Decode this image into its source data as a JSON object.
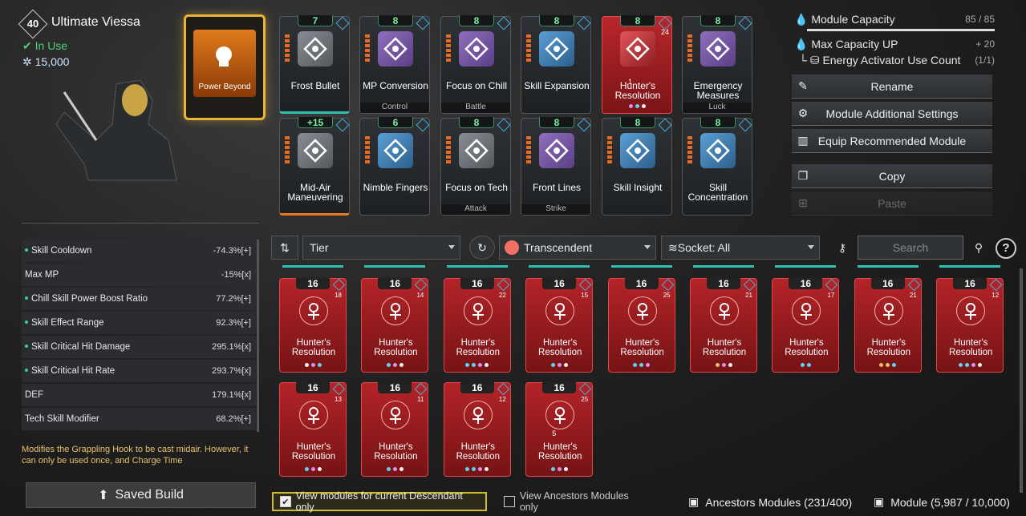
{
  "character": {
    "level": "40",
    "name": "Ultimate Viessa",
    "status": "In Use",
    "gold": "15,000"
  },
  "power_beyond": {
    "label": "Power Beyond"
  },
  "equipped": [
    {
      "badge": "7",
      "name": "Frost Bullet",
      "sub": "",
      "color": "gray"
    },
    {
      "badge": "8",
      "name": "MP Conversion",
      "sub": "Control",
      "color": "purple"
    },
    {
      "badge": "8",
      "name": "Focus on Chill",
      "sub": "Battle",
      "color": "purple"
    },
    {
      "badge": "8",
      "name": "Skill Expansion",
      "sub": "",
      "color": "blue"
    },
    {
      "badge": "8",
      "name": "Hunter's Resolution",
      "sub": "",
      "color": "red",
      "rank": "24",
      "count": "1"
    },
    {
      "badge": "8",
      "name": "Emergency Measures",
      "sub": "Luck",
      "color": "purple"
    },
    {
      "badge": "+15",
      "name": "Mid-Air Maneuvering",
      "sub": "",
      "color": "gray"
    },
    {
      "badge": "6",
      "name": "Nimble Fingers",
      "sub": "",
      "color": "blue"
    },
    {
      "badge": "8",
      "name": "Focus on Tech",
      "sub": "Attack",
      "color": "gray"
    },
    {
      "badge": "8",
      "name": "Front Lines",
      "sub": "Strike",
      "color": "purple"
    },
    {
      "badge": "8",
      "name": "Skill Insight",
      "sub": "",
      "color": "blue"
    },
    {
      "badge": "8",
      "name": "Skill Concentration",
      "sub": "",
      "color": "blue"
    }
  ],
  "capacity": {
    "label": "Module Capacity",
    "value": "85 / 85",
    "fill": 1.0,
    "max_label": "Max Capacity UP",
    "max_value": "+ 20",
    "energy_label": "Energy Activator Use Count",
    "energy_value": "(1/1)"
  },
  "buttons": {
    "rename": "Rename",
    "additional": "Module Additional Settings",
    "recommended": "Equip Recommended Module",
    "copy": "Copy",
    "paste": "Paste"
  },
  "stats": [
    {
      "name": "Skill Cooldown",
      "value": "-74.3%[+]",
      "dot": true
    },
    {
      "name": "Max MP",
      "value": "-15%[x]",
      "dot": false
    },
    {
      "name": "Chill Skill Power Boost Ratio",
      "value": "77.2%[+]",
      "dot": true
    },
    {
      "name": "Skill Effect Range",
      "value": "92.3%[+]",
      "dot": true
    },
    {
      "name": "Skill Critical Hit Damage",
      "value": "295.1%[x]",
      "dot": true
    },
    {
      "name": "Skill Critical Hit Rate",
      "value": "293.7%[x]",
      "dot": true
    },
    {
      "name": "DEF",
      "value": "179.1%[x]",
      "dot": false
    },
    {
      "name": "Tech Skill Modifier",
      "value": "68.2%[+]",
      "dot": false
    }
  ],
  "description": "Modifies the Grappling Hook to be cast midair. However, it can only be used once, and Charge Time",
  "saved_build": "Saved Build",
  "filters": {
    "tier": "Tier",
    "rarity": "Transcendent",
    "socket": "Socket: All",
    "search_placeholder": "Search",
    "help": "?"
  },
  "inventory": [
    {
      "badge": "16",
      "rank": "18",
      "name": "Hunter's Resolution"
    },
    {
      "badge": "16",
      "rank": "14",
      "name": "Hunter's Resolution"
    },
    {
      "badge": "16",
      "rank": "22",
      "name": "Hunter's Resolution"
    },
    {
      "badge": "16",
      "rank": "15",
      "name": "Hunter's Resolution"
    },
    {
      "badge": "16",
      "rank": "25",
      "name": "Hunter's Resolution"
    },
    {
      "badge": "16",
      "rank": "21",
      "name": "Hunter's Resolution"
    },
    {
      "badge": "16",
      "rank": "17",
      "name": "Hunter's Resolution"
    },
    {
      "badge": "16",
      "rank": "21",
      "name": "Hunter's Resolution"
    },
    {
      "badge": "16",
      "rank": "12",
      "name": "Hunter's Resolution"
    },
    {
      "badge": "16",
      "rank": "13",
      "name": "Hunter's Resolution"
    },
    {
      "badge": "16",
      "rank": "11",
      "name": "Hunter's Resolution"
    },
    {
      "badge": "16",
      "rank": "12",
      "name": "Hunter's Resolution"
    },
    {
      "badge": "16",
      "rank": "25",
      "name": "Hunter's Resolution",
      "count": "5"
    }
  ],
  "bottom": {
    "view_current": "View modules for current Descendant only",
    "view_ancestors": "View Ancestors Modules only",
    "ancestors_count": "Ancestors Modules (231/400)",
    "module_count": "Module (5,987 / 10,000)"
  },
  "colors": {
    "accent_green": "#4ccf7b",
    "transcendent": "#f27164",
    "gold_border": "#e8b43a"
  }
}
